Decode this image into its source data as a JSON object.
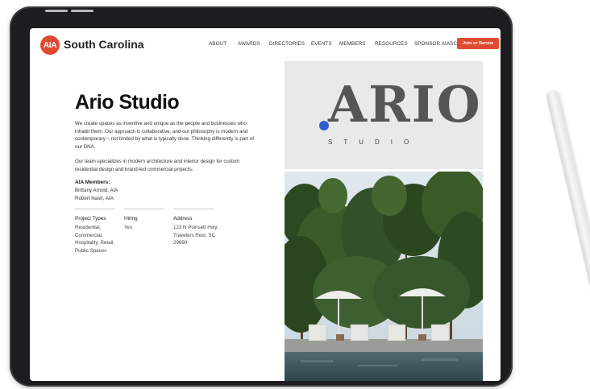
{
  "header": {
    "logo_badge": "AIA",
    "logo_text": "South Carolina",
    "menu": [
      "ABOUT",
      "AWARDS",
      "DIRECTORIES",
      "EVENTS",
      "MEMBERS",
      "RESOURCES",
      "SPONSOR AIASC"
    ],
    "cta": "Join or Renew"
  },
  "profile": {
    "title": "Ario Studio",
    "paragraphs": [
      "We create spaces as inventive and unique as the people and businesses who inhabit them. Our approach is collaborative, and our philosophy is modern and contemporary – not limited by what is typically done. Thinking differently is part of our DNA.",
      "Our team specializes in modern architecture and interior design for custom residential design and brand-led commercial projects."
    ],
    "members_heading": "AIA Members:",
    "members": [
      "Brittany Arnold, AIA",
      "Robert Nash, AIA"
    ],
    "details": [
      {
        "label": "Project Types",
        "value": "Residential, Commercial, Hospitality, Retail, Public Spaces"
      },
      {
        "label": "Hiring",
        "value": "Yes"
      },
      {
        "label": "Address",
        "value": "123 N Poinsett Hwy, Travelers Rest, SC 29690"
      }
    ]
  },
  "brand_logo": {
    "word": "ARIO",
    "sub": "STUDIO",
    "accent_color": "#2f5fd2"
  },
  "colors": {
    "brand_red": "#e04a33"
  }
}
